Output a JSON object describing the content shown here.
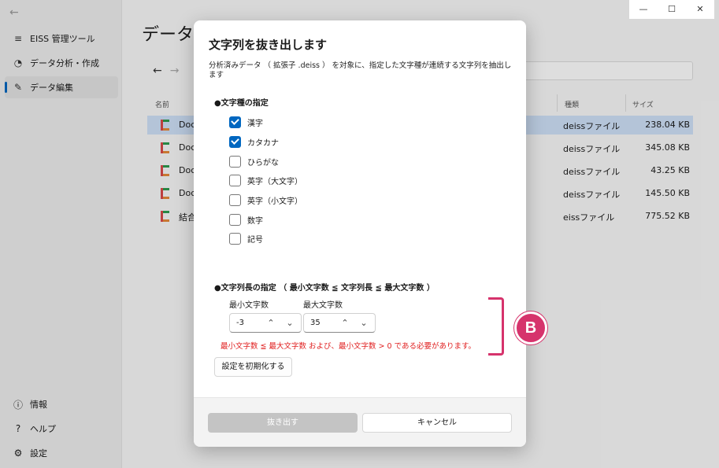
{
  "app": {
    "title": "EISS 管理ツール",
    "page_title": "データ編",
    "window_controls": [
      "—",
      "☐",
      "✕"
    ]
  },
  "sidebar": {
    "items": [
      {
        "label": "EISS 管理ツール",
        "icon": "menu-icon"
      },
      {
        "label": "データ分析・作成",
        "icon": "chart-icon"
      },
      {
        "label": "データ編集",
        "icon": "pencil-icon"
      }
    ],
    "bottom": [
      {
        "label": "情報",
        "icon": "info-icon"
      },
      {
        "label": "ヘルプ",
        "icon": "help-icon"
      },
      {
        "label": "設定",
        "icon": "gear-icon"
      }
    ]
  },
  "file_table": {
    "headers": {
      "name": "名前",
      "type": "種類",
      "size": "サイズ"
    },
    "rows": [
      {
        "name": "Doc",
        "type": "deissファイル",
        "size": "238.04 KB"
      },
      {
        "name": "Doc",
        "type": "deissファイル",
        "size": "345.08 KB"
      },
      {
        "name": "Doc",
        "type": "deissファイル",
        "size": "43.25 KB"
      },
      {
        "name": "Doc",
        "type": "deissファイル",
        "size": "145.50 KB"
      },
      {
        "name": "結合",
        "type": "eissファイル",
        "size": "775.52 KB"
      }
    ]
  },
  "dialog": {
    "title": "文字列を抜き出します",
    "description": "分析済みデータ （ 拡張子 .deiss ） を対象に、指定した文字種が連続する文字列を抽出します",
    "char_type_section": "●文字種の指定",
    "checkboxes": [
      {
        "label": "漢字",
        "checked": true
      },
      {
        "label": "カタカナ",
        "checked": true
      },
      {
        "label": "ひらがな",
        "checked": false
      },
      {
        "label": "英字（大文字）",
        "checked": false
      },
      {
        "label": "英字（小文字）",
        "checked": false
      },
      {
        "label": "数字",
        "checked": false
      },
      {
        "label": "記号",
        "checked": false
      }
    ],
    "length_section": "●文字列長の指定 （ 最小文字数 ≦ 文字列長 ≦ 最大文字数 ）",
    "min_label": "最小文字数",
    "max_label": "最大文字数",
    "min_value": "-3",
    "max_value": "35",
    "error": "最小文字数 ≦ 最大文字数 および、最小文字数 > 0 である必要があります。",
    "reset_button": "設定を初期化する",
    "extract_button": "抜き出す",
    "cancel_button": "キャンセル"
  },
  "annotation": {
    "marker": "B",
    "color": "#d6336c"
  },
  "colors": {
    "accent": "#0067c0",
    "error": "#e02020"
  }
}
